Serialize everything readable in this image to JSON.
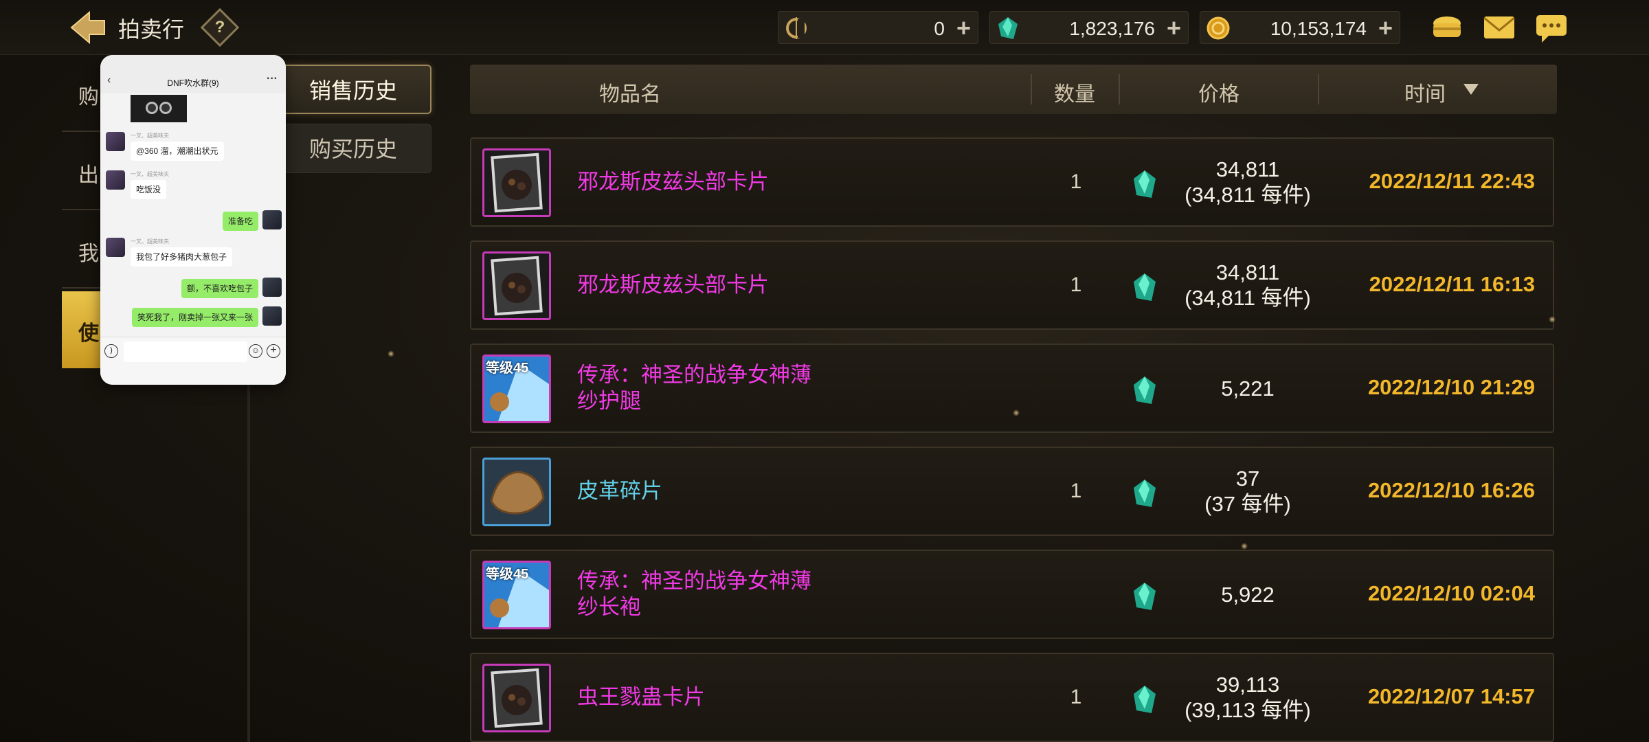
{
  "header": {
    "title": "拍卖行",
    "help_label": "?"
  },
  "currencies": [
    {
      "name": "coupon",
      "icon": "c-coin-icon",
      "value": "0"
    },
    {
      "name": "crystal",
      "icon": "green-gem-icon",
      "value": "1,823,176"
    },
    {
      "name": "gold",
      "icon": "gold-coin-icon",
      "value": "10,153,174"
    }
  ],
  "plus_label": "+",
  "left_menu": {
    "items": [
      "购",
      "出",
      "我"
    ],
    "use_button": "使"
  },
  "tabs": {
    "sales_history": "销售历史",
    "purchase_history": "购买历史"
  },
  "table": {
    "headers": {
      "item_name": "物品名",
      "quantity": "数量",
      "price": "价格",
      "time": "时间"
    },
    "rows": [
      {
        "name_line1": "邪龙斯皮兹头部卡片",
        "name_line2": "",
        "name_color": "magenta",
        "icon": "card-icon",
        "icon_border": "magenta",
        "qty": "1",
        "price": "34,811",
        "per_unit": "(34,811 每件)",
        "time": "2022/12/11 22:43"
      },
      {
        "name_line1": "邪龙斯皮兹头部卡片",
        "name_line2": "",
        "name_color": "magenta",
        "icon": "card-icon",
        "icon_border": "magenta",
        "qty": "1",
        "price": "34,811",
        "per_unit": "(34,811 每件)",
        "time": "2022/12/11 16:13"
      },
      {
        "name_line1": "传承：神圣的战争女神薄",
        "name_line2": "纱护腿",
        "name_color": "magenta",
        "icon": "armor-level45-icon",
        "icon_border": "magenta",
        "qty": "",
        "price": "5,221",
        "per_unit": "",
        "time": "2022/12/10 21:29",
        "level_badge": "等级45"
      },
      {
        "name_line1": "皮革碎片",
        "name_line2": "",
        "name_color": "cyan",
        "icon": "leather-scrap-icon",
        "icon_border": "blue",
        "qty": "1",
        "price": "37",
        "per_unit": "(37 每件)",
        "time": "2022/12/10 16:26"
      },
      {
        "name_line1": "传承：神圣的战争女神薄",
        "name_line2": "纱长袍",
        "name_color": "magenta",
        "icon": "armor-level45-icon",
        "icon_border": "magenta",
        "qty": "",
        "price": "5,922",
        "per_unit": "",
        "time": "2022/12/10 02:04",
        "level_badge": "等级45"
      },
      {
        "name_line1": "虫王戮蛊卡片",
        "name_line2": "",
        "name_color": "magenta",
        "icon": "card-icon",
        "icon_border": "magenta",
        "qty": "1",
        "price": "39,113",
        "per_unit": "(39,113 每件)",
        "time": "2022/12/07 14:57"
      }
    ]
  },
  "chat": {
    "group_name": "DNF吹水群(9)",
    "sender_label": "一叉、超美味夫",
    "messages": [
      {
        "side": "left",
        "text": "@360 溜，潮潮出状元"
      },
      {
        "side": "left",
        "text": "吃饭没"
      },
      {
        "side": "right",
        "text": "准备吃"
      },
      {
        "side": "left",
        "text": "我包了好多猪肉大葱包子"
      },
      {
        "side": "right",
        "text": "额，不喜欢吃包子"
      },
      {
        "side": "right",
        "text": "笑死我了，刚卖掉一张又来一张"
      }
    ]
  },
  "colors": {
    "magenta": "#f23ae6",
    "cyan": "#62d0e8",
    "time": "#f3b82a",
    "use_button": "#e0b53a"
  }
}
